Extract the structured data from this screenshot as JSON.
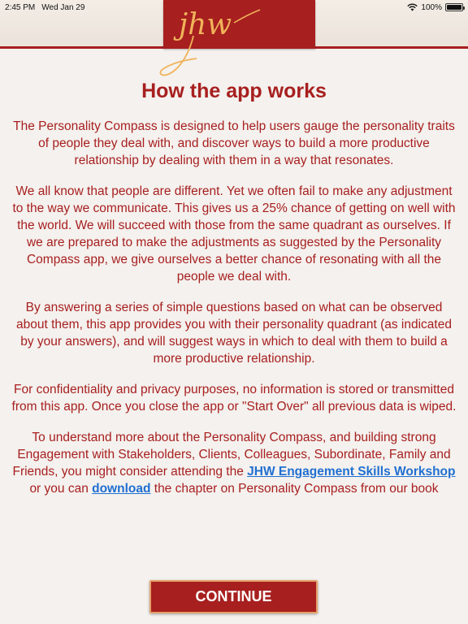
{
  "status": {
    "time": "2:45 PM",
    "date": "Wed Jan 29",
    "battery": "100%",
    "battery_level": 1.0
  },
  "logo": {
    "text": "jhw"
  },
  "title": "How the app works",
  "paragraphs": [
    "The Personality Compass is designed to help users gauge the personality traits of people they deal with, and discover ways to build a more productive relationship by dealing with them in a way that resonates.",
    "We all know that people are different. Yet we often fail to make any adjustment to the way we communicate. This gives us a 25% chance of getting on well with the world. We will succeed with those from the same quadrant as ourselves. If we are prepared to make the adjustments as suggested by the Personality Compass app, we give ourselves a better chance of resonating with all the people we deal with.",
    "By answering a series of simple questions based on what can be observed about them, this app provides you with their personality quadrant (as indicated by your answers), and will suggest ways in which to deal with them to build a more productive relationship.",
    "For confidentiality and privacy purposes, no information is stored or transmitted from this app. Once you close the app or \"Start Over\" all previous data is wiped."
  ],
  "last_paragraph": {
    "text_before": "To understand more about the Personality Compass, and building strong Engagement with Stakeholders, Clients, Colleagues, Subordinate, Family and Friends, you might consider attending the ",
    "workshop_link": "JHW Engagement Skills Workshop ",
    "text_middle": "or you can ",
    "download_link": "download",
    "text_after": " the chapter on Personality Compass from our book"
  },
  "continue_label": "CONTINUE",
  "colors": {
    "brand_red": "#a71f1f",
    "background": "#f4f1ee",
    "link_blue": "#1f6fd1",
    "logo_gold": "#f0b35a"
  }
}
